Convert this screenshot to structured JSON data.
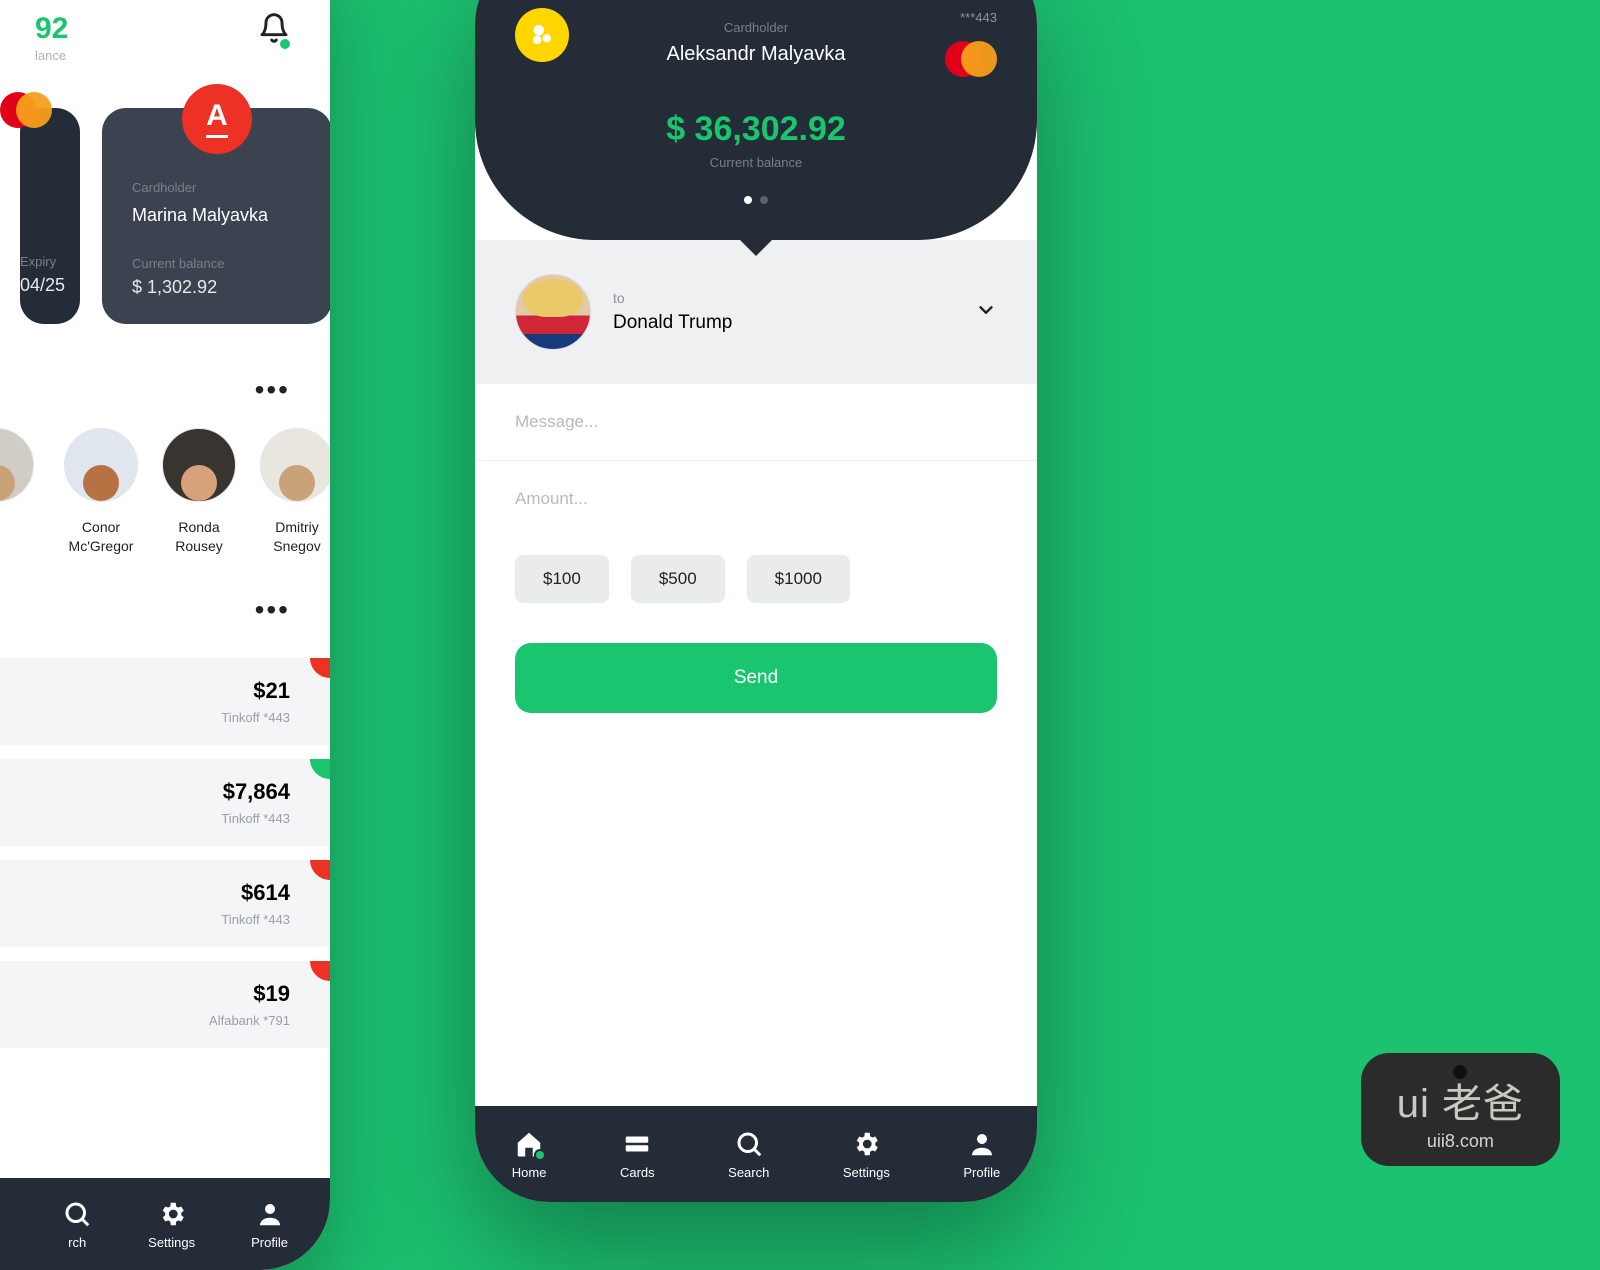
{
  "left": {
    "balance_partial": "92",
    "balance_partial_label": "lance",
    "card1": {
      "expiry_label": "Expiry",
      "expiry": "04/25"
    },
    "card2": {
      "ch_label": "Cardholder",
      "name": "Marina Malyavka",
      "bal_label": "Current balance",
      "balance": "$ 1,302.92"
    },
    "contacts": [
      {
        "name_l1": "Conor",
        "name_l2": "Mc'Gregor"
      },
      {
        "name_l1": "Ronda",
        "name_l2": "Rousey"
      },
      {
        "name_l1": "Dmitriy",
        "name_l2": "Snegov"
      }
    ],
    "tx": [
      {
        "amount": "$21",
        "sub": "Tinkoff *443",
        "color": "red"
      },
      {
        "amount": "$7,864",
        "sub": "Tinkoff *443",
        "color": "green"
      },
      {
        "amount": "$614",
        "sub": "Tinkoff *443",
        "color": "red"
      },
      {
        "amount": "$19",
        "sub": "Alfabank *791",
        "color": "red"
      }
    ],
    "nav": {
      "search": "rch",
      "settings": "Settings",
      "profile": "Profile"
    }
  },
  "right": {
    "ch_label": "Cardholder",
    "ch_name": "Aleksandr Malyavka",
    "card_no": "***443",
    "balance": "$ 36,302.92",
    "bal_label": "Current balance",
    "recipient_label": "to",
    "recipient_name": "Donald Trump",
    "message_ph": "Message...",
    "amount_ph": "Amount...",
    "chips": [
      "$100",
      "$500",
      "$1000"
    ],
    "send_label": "Send",
    "nav": {
      "home": "Home",
      "cards": "Cards",
      "search": "Search",
      "settings": "Settings",
      "profile": "Profile"
    }
  },
  "watermark": {
    "logo": "ui 老爸",
    "url": "uii8.com"
  },
  "colors": {
    "accent": "#19c56e",
    "bg": "#1cc270",
    "dark": "#242c37"
  }
}
